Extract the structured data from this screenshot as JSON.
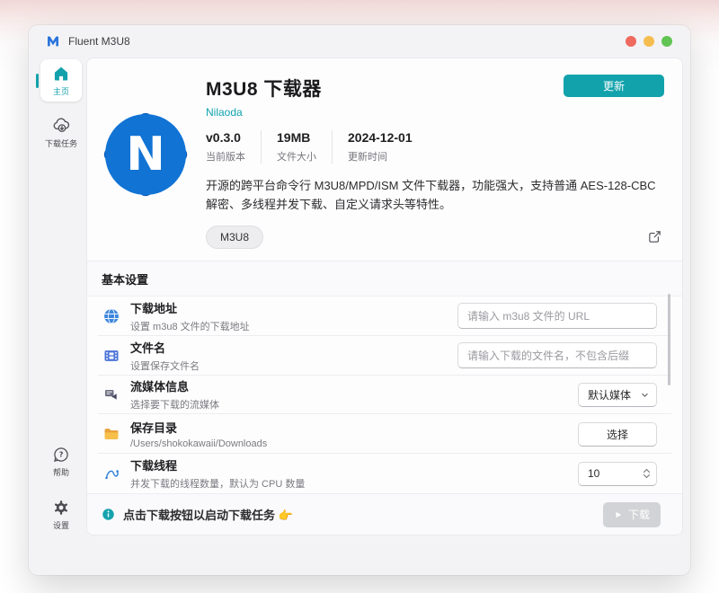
{
  "window": {
    "title": "Fluent M3U8",
    "traffic_light_colors": [
      "#ee6a5f",
      "#f5bd4f",
      "#61c454"
    ]
  },
  "sidebar": {
    "items": [
      {
        "label": "主页",
        "icon": "home-icon",
        "active": true
      },
      {
        "label": "下载任务",
        "icon": "cloud-download-icon",
        "active": false
      }
    ],
    "bottom_items": [
      {
        "label": "帮助",
        "icon": "help-icon"
      },
      {
        "label": "设置",
        "icon": "gear-icon"
      }
    ]
  },
  "header": {
    "title": "M3U8 下载器",
    "author": "Nilaoda",
    "update_button": "更新",
    "app_icon_letter": "N",
    "stats": [
      {
        "value": "v0.3.0",
        "label": "当前版本"
      },
      {
        "value": "19MB",
        "label": "文件大小"
      },
      {
        "value": "2024-12-01",
        "label": "更新时间"
      }
    ],
    "description": "开源的跨平台命令行 M3U8/MPD/ISM 文件下载器，功能强大，支持普通 AES-128-CBC 解密、多线程并发下载、自定义请求头等特性。",
    "tag": "M3U8"
  },
  "settings": {
    "section_title": "基本设置",
    "rows": [
      {
        "icon": "globe-icon",
        "title": "下载地址",
        "subtitle": "设置 m3u8 文件的下载地址",
        "control": "input",
        "placeholder": "请输入 m3u8 文件的 URL"
      },
      {
        "icon": "film-icon",
        "title": "文件名",
        "subtitle": "设置保存文件名",
        "control": "input",
        "placeholder": "请输入下载的文件名，不包含后缀"
      },
      {
        "icon": "stream-media-icon",
        "title": "流媒体信息",
        "subtitle": "选择要下载的流媒体",
        "control": "select",
        "value": "默认媒体"
      },
      {
        "icon": "folder-icon",
        "title": "保存目录",
        "subtitle": "/Users/shokokawaii/Downloads",
        "control": "button",
        "value": "选择"
      },
      {
        "icon": "threads-icon",
        "title": "下载线程",
        "subtitle": "并发下载的线程数量，默认为 CPU 数量",
        "control": "number",
        "value": "10"
      }
    ]
  },
  "footer": {
    "hint": "点击下载按钮以启动下载任务 👉",
    "download_button": "下载"
  },
  "colors": {
    "accent_teal": "#12a2ac",
    "app_icon_blue": "#1173d4",
    "app_icon_shadow_blue": "#0c5ab4",
    "disabled_button": "#d2d3d6"
  }
}
